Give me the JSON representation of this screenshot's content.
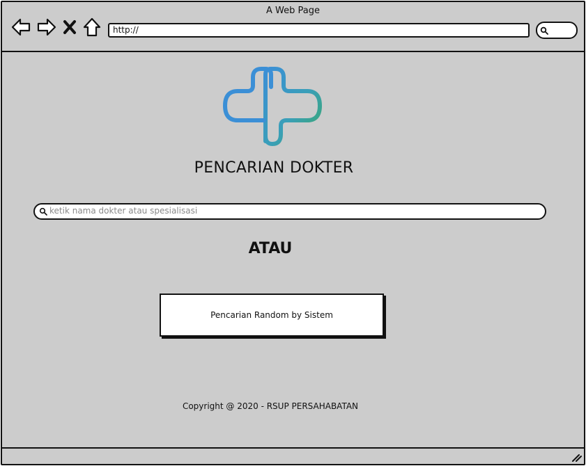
{
  "window": {
    "title": "A Web Page",
    "address": "http://"
  },
  "nav": {
    "icons": [
      "back-icon",
      "forward-icon",
      "close-icon",
      "home-icon",
      "search-icon"
    ]
  },
  "main": {
    "logo": "medical-cross-logo",
    "title": "PENCARIAN DOKTER",
    "search": {
      "placeholder": "ketik nama dokter atau spesialisasi",
      "value": ""
    },
    "or_label": "ATAU",
    "random_button_label": "Pencarian Random by Sistem"
  },
  "footer": {
    "copyright": "Copyright @ 2020 - RSUP PERSAHABATAN"
  },
  "colors": {
    "window_background": "#cccccc",
    "logo_blue": "#3b8fd6",
    "logo_green": "#3aa86a",
    "border": "#111111"
  }
}
